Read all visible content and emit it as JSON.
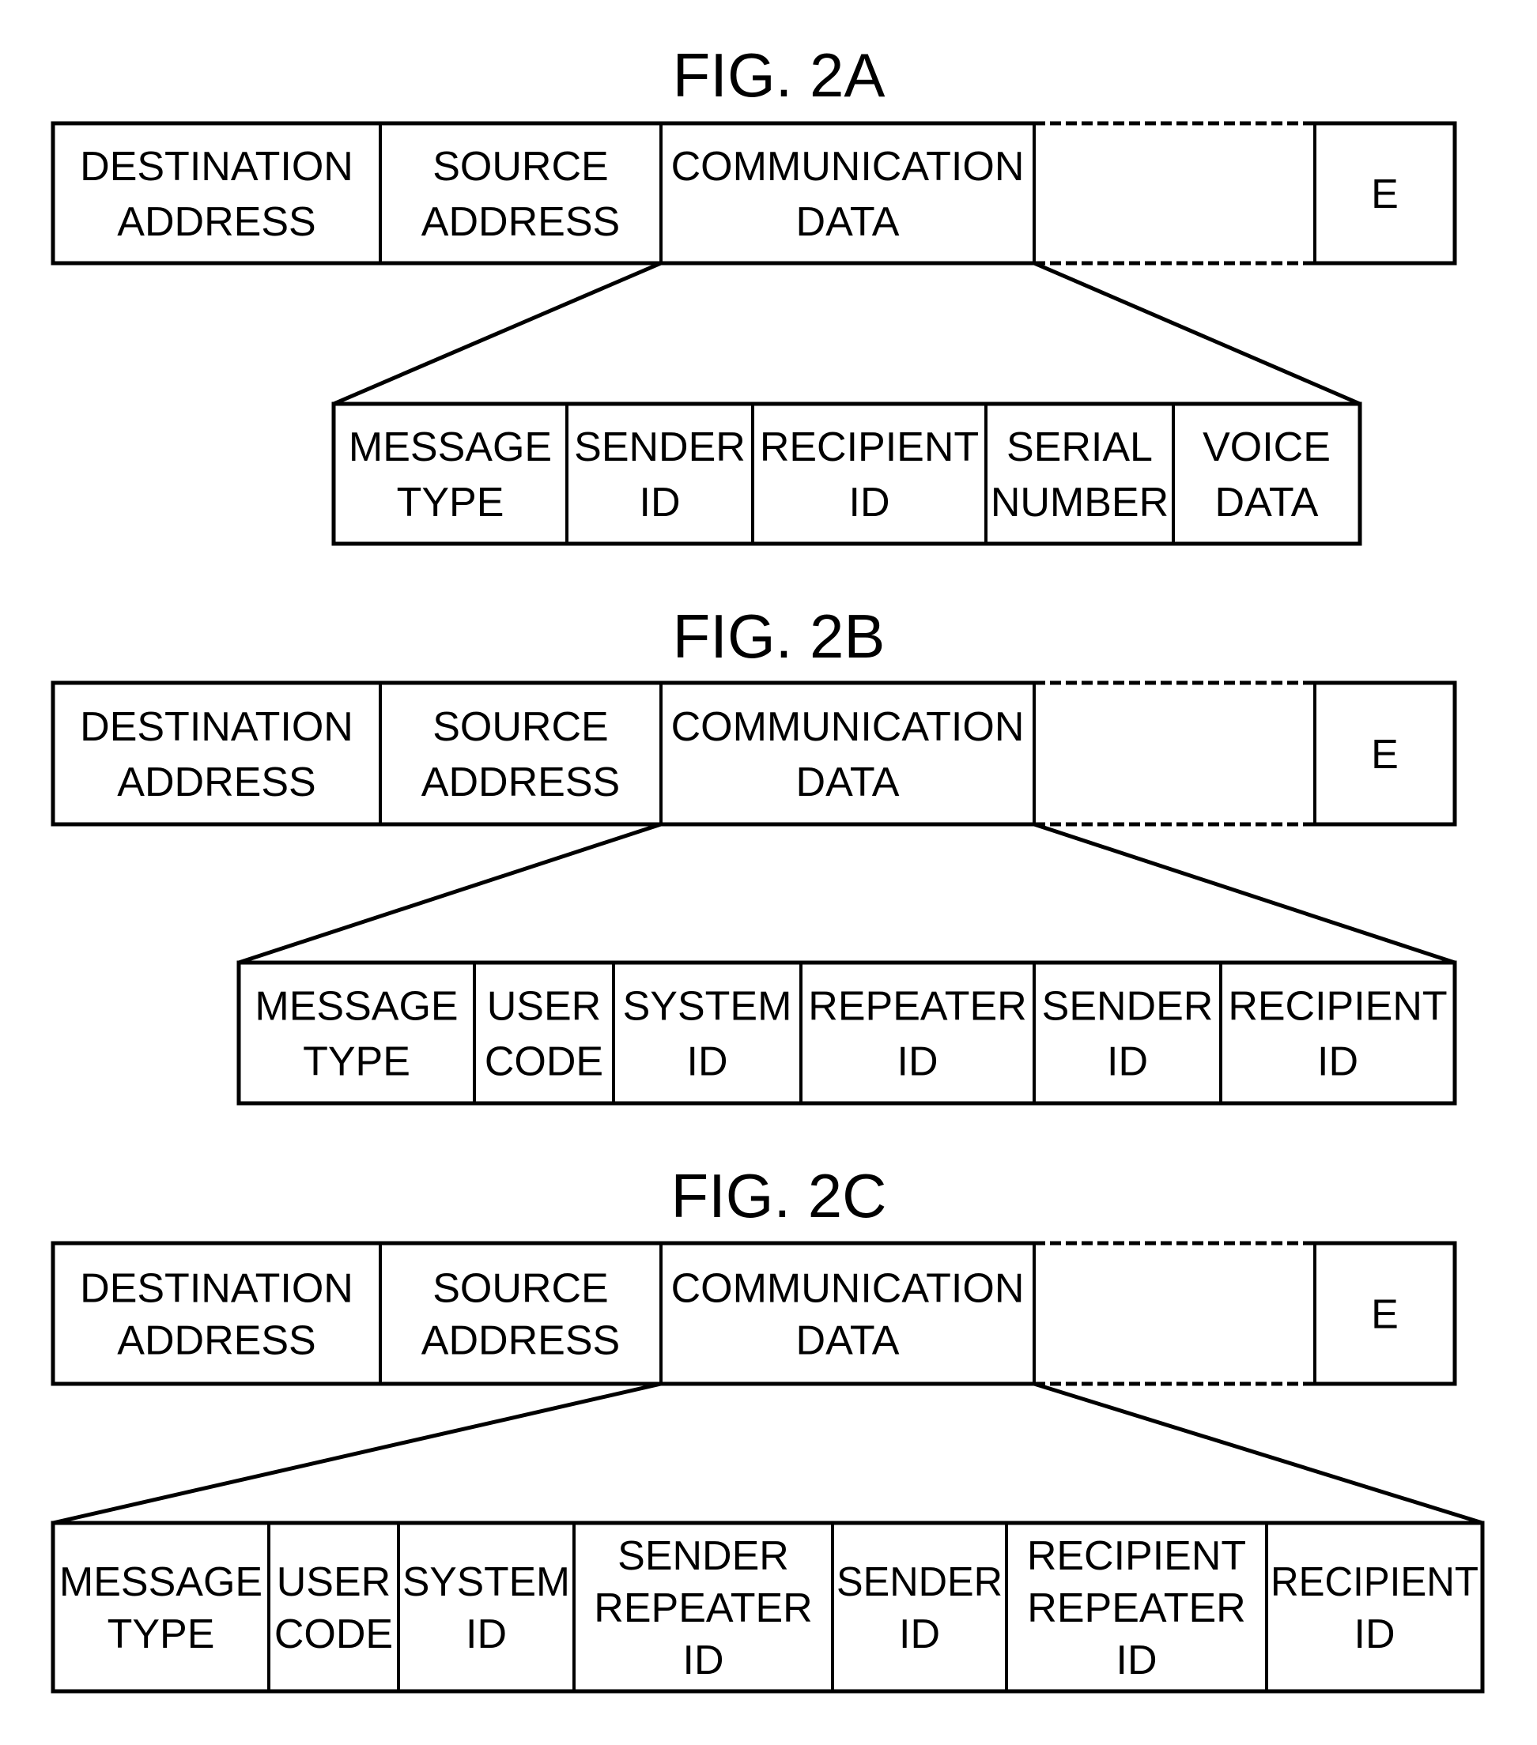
{
  "figures": [
    {
      "id": "2A",
      "title": "FIG. 2A",
      "frame_fields": [
        {
          "lines": [
            "DESTINATION",
            "ADDRESS"
          ]
        },
        {
          "lines": [
            "SOURCE",
            "ADDRESS"
          ]
        },
        {
          "lines": [
            "COMMUNICATION",
            "DATA"
          ]
        },
        {
          "lines": [],
          "style": "dashed"
        },
        {
          "lines": [
            "E"
          ]
        }
      ],
      "expanded_field_index": 2,
      "sub_fields": [
        {
          "lines": [
            "MESSAGE",
            "TYPE"
          ]
        },
        {
          "lines": [
            "SENDER",
            "ID"
          ]
        },
        {
          "lines": [
            "RECIPIENT",
            "ID"
          ]
        },
        {
          "lines": [
            "SERIAL",
            "NUMBER"
          ]
        },
        {
          "lines": [
            "VOICE",
            "DATA"
          ]
        }
      ]
    },
    {
      "id": "2B",
      "title": "FIG. 2B",
      "frame_fields": [
        {
          "lines": [
            "DESTINATION",
            "ADDRESS"
          ]
        },
        {
          "lines": [
            "SOURCE",
            "ADDRESS"
          ]
        },
        {
          "lines": [
            "COMMUNICATION",
            "DATA"
          ]
        },
        {
          "lines": [],
          "style": "dashed"
        },
        {
          "lines": [
            "E"
          ]
        }
      ],
      "expanded_field_index": 2,
      "sub_fields": [
        {
          "lines": [
            "MESSAGE",
            "TYPE"
          ]
        },
        {
          "lines": [
            "USER",
            "CODE"
          ]
        },
        {
          "lines": [
            "SYSTEM",
            "ID"
          ]
        },
        {
          "lines": [
            "REPEATER",
            "ID"
          ]
        },
        {
          "lines": [
            "SENDER",
            "ID"
          ]
        },
        {
          "lines": [
            "RECIPIENT",
            "ID"
          ]
        }
      ]
    },
    {
      "id": "2C",
      "title": "FIG. 2C",
      "frame_fields": [
        {
          "lines": [
            "DESTINATION",
            "ADDRESS"
          ]
        },
        {
          "lines": [
            "SOURCE",
            "ADDRESS"
          ]
        },
        {
          "lines": [
            "COMMUNICATION",
            "DATA"
          ]
        },
        {
          "lines": [],
          "style": "dashed"
        },
        {
          "lines": [
            "E"
          ]
        }
      ],
      "expanded_field_index": 2,
      "sub_fields": [
        {
          "lines": [
            "MESSAGE",
            "TYPE"
          ]
        },
        {
          "lines": [
            "USER",
            "CODE"
          ]
        },
        {
          "lines": [
            "SYSTEM",
            "ID"
          ]
        },
        {
          "lines": [
            "SENDER",
            "REPEATER",
            "ID"
          ]
        },
        {
          "lines": [
            "SENDER",
            "ID"
          ]
        },
        {
          "lines": [
            "RECIPIENT",
            "REPEATER",
            "ID"
          ]
        },
        {
          "lines": [
            "RECIPIENT",
            "ID"
          ]
        }
      ]
    }
  ]
}
